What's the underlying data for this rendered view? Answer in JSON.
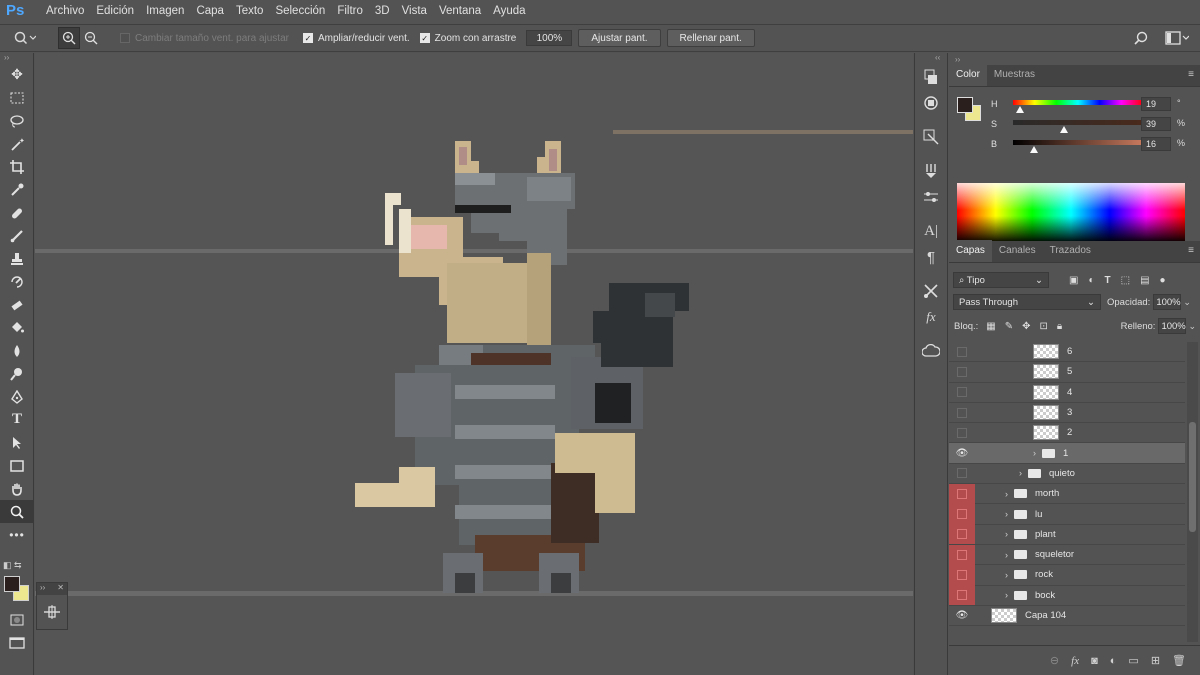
{
  "menubar": {
    "logo": "Ps",
    "items": [
      "Archivo",
      "Edición",
      "Imagen",
      "Capa",
      "Texto",
      "Selección",
      "Filtro",
      "3D",
      "Vista",
      "Ventana",
      "Ayuda"
    ]
  },
  "options": {
    "resize_windows": "Cambiar tamaño vent. para ajustar",
    "zoom_all": "Ampliar/reducir vent.",
    "scrubby_zoom": "Zoom con arrastre",
    "zoom_value": "100%",
    "fit_screen": "Ajustar pant.",
    "fill_screen": "Rellenar pant."
  },
  "colors": {
    "foreground": "#2a1f1c",
    "background": "#ede890",
    "accent": "#b34c4c"
  },
  "color_panel": {
    "tabs": [
      "Color",
      "Muestras"
    ],
    "h_label": "H",
    "h_value": "19",
    "h_unit": "°",
    "s_label": "S",
    "s_value": "39",
    "s_unit": "%",
    "b_label": "B",
    "b_value": "16",
    "b_unit": "%",
    "h_level": 0.05,
    "s_level": 0.39,
    "b_level": 0.16
  },
  "layers_panel": {
    "tabs": [
      "Capas",
      "Canales",
      "Trazados"
    ],
    "filter": "Tipo",
    "blend_mode": "Pass Through",
    "opacity_label": "Opacidad:",
    "opacity_value": "100%",
    "lock_label": "Bloq.:",
    "fill_label": "Relleno:",
    "fill_value": "100%",
    "layers": [
      {
        "name": "6",
        "type": "layer",
        "visible": false,
        "indent": 2,
        "red": false
      },
      {
        "name": "5",
        "type": "layer",
        "visible": false,
        "indent": 2,
        "red": false
      },
      {
        "name": "4",
        "type": "layer",
        "visible": false,
        "indent": 2,
        "red": false
      },
      {
        "name": "3",
        "type": "layer",
        "visible": false,
        "indent": 2,
        "red": false
      },
      {
        "name": "2",
        "type": "layer",
        "visible": false,
        "indent": 2,
        "red": false
      },
      {
        "name": "1",
        "type": "folder",
        "visible": true,
        "indent": 2,
        "red": false,
        "selected": true
      },
      {
        "name": "quieto",
        "type": "folder",
        "visible": false,
        "indent": 1,
        "red": false
      },
      {
        "name": "morth",
        "type": "folder",
        "visible": false,
        "indent": 0,
        "red": true
      },
      {
        "name": "lu",
        "type": "folder",
        "visible": false,
        "indent": 0,
        "red": true
      },
      {
        "name": "plant",
        "type": "folder",
        "visible": false,
        "indent": 0,
        "red": true
      },
      {
        "name": "squeletor",
        "type": "folder",
        "visible": false,
        "indent": 0,
        "red": true
      },
      {
        "name": "rock",
        "type": "folder",
        "visible": false,
        "indent": 0,
        "red": true
      },
      {
        "name": "bock",
        "type": "folder",
        "visible": false,
        "indent": 0,
        "red": true
      },
      {
        "name": "Capa 104",
        "type": "layer",
        "visible": true,
        "indent": -1,
        "red": false
      }
    ]
  }
}
